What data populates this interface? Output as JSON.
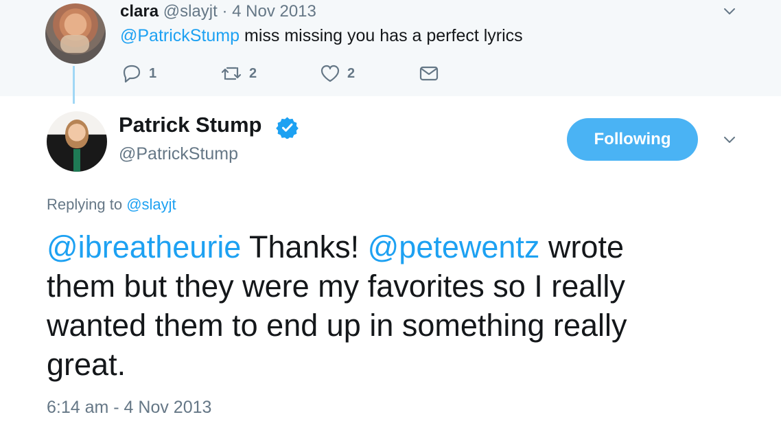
{
  "parent_tweet": {
    "name": "clara",
    "handle": "@slayjt",
    "separator": "·",
    "date": "4 Nov 2013",
    "mention": "@PatrickStump",
    "text": " miss missing you has a perfect lyrics",
    "actions": {
      "reply_count": "1",
      "retweet_count": "2",
      "like_count": "2"
    }
  },
  "main_tweet": {
    "name": "Patrick Stump",
    "handle": "@PatrickStump",
    "follow_button_label": "Following",
    "replying_prefix": "Replying to ",
    "replying_handle": "@slayjt",
    "line1": {
      "mention1": "@ibreatheurie",
      "text1": " Thanks! ",
      "mention2": "@petewentz",
      "text2": " wrote"
    },
    "line2": "them but they were my favorites so I really",
    "line3": "wanted them to end up in something really",
    "line4": "great.",
    "timestamp": "6:14 am - 4 Nov 2013"
  },
  "colors": {
    "accent": "#1da1f2",
    "follow_button": "#4ab3f4",
    "secondary_text": "#657786",
    "thread_line": "#a0d7f5"
  },
  "icons": {
    "parent_menu": "chevron-down-icon",
    "reply": "reply-icon",
    "retweet": "retweet-icon",
    "like": "heart-icon",
    "direct_message": "mail-icon",
    "verified": "verified-badge-icon",
    "main_menu": "chevron-down-icon"
  }
}
